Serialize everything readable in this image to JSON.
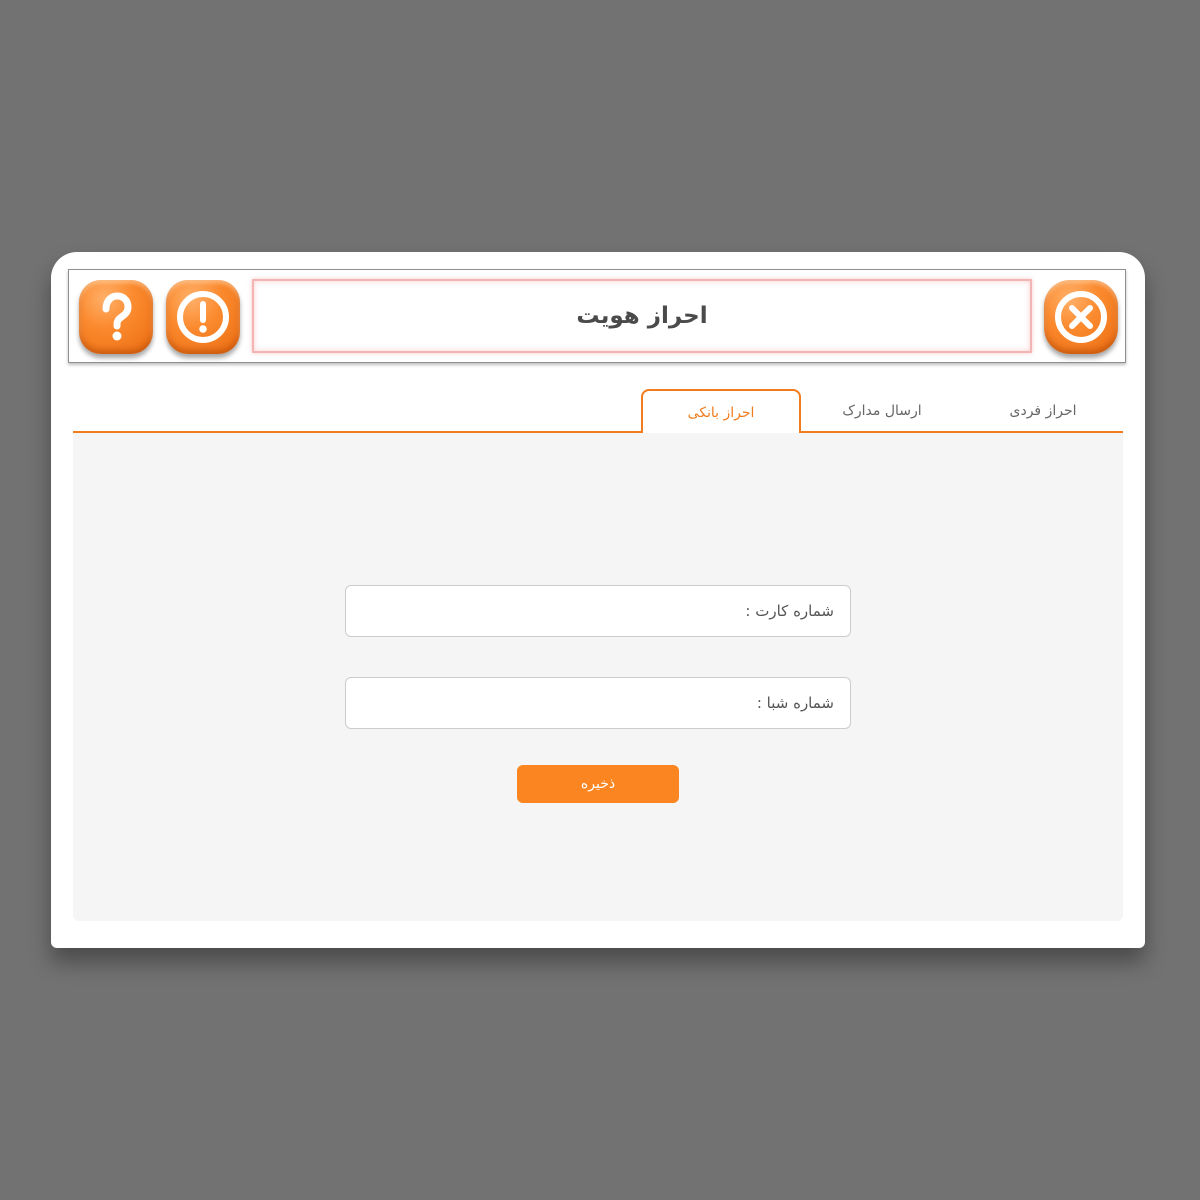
{
  "dialog": {
    "title": "احراز هویت",
    "icons": {
      "help": "question-icon",
      "info": "exclamation-icon",
      "close": "close-icon"
    },
    "accent_color": "#f07c1e"
  },
  "tabs": [
    {
      "label": "احراز فردی",
      "active": false
    },
    {
      "label": "ارسال مدارک",
      "active": false
    },
    {
      "label": "احراز بانکی",
      "active": true
    }
  ],
  "form": {
    "card_number_label": "شماره کارت :",
    "card_number_value": "",
    "sheba_label": "شماره شبا :",
    "sheba_value": "",
    "save_label": "ذخیره"
  }
}
